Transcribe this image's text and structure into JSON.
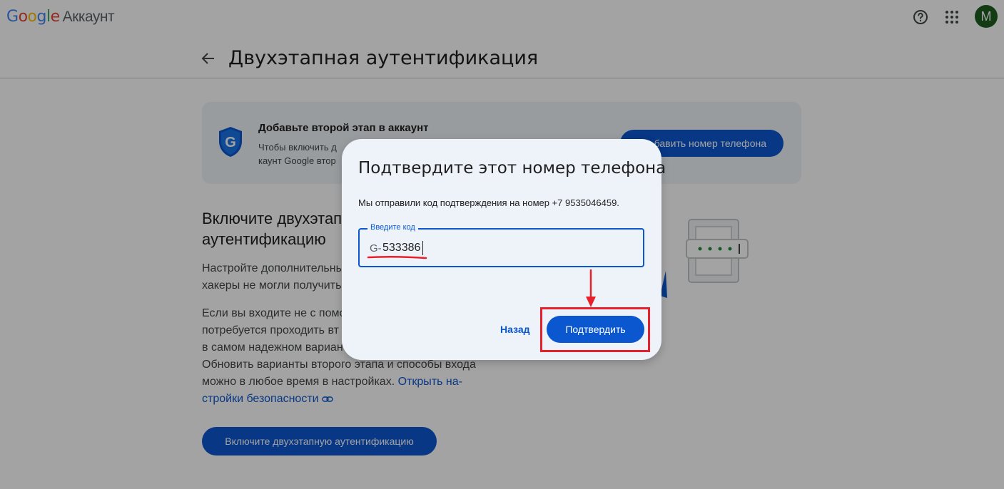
{
  "header": {
    "logo_letters": [
      "G",
      "o",
      "o",
      "g",
      "l",
      "e"
    ],
    "logo_suffix": "Аккаунт",
    "avatar_letter": "M"
  },
  "title_row": {
    "title": "Двухэтапная аутентификация"
  },
  "banner": {
    "title": "Добавьте второй этап в аккаунт",
    "line1": "Чтобы включить д",
    "line2": "каунт Google втор",
    "button_label": "бавить номер телефона"
  },
  "section": {
    "title_line1": "Включите двухэтап",
    "title_line2": "аутентификацию",
    "para1_line1": "Настройте дополнительны",
    "para1_line2": "хакеры не могли получить",
    "para2_line1": "Если вы входите не с помо",
    "para2_line2": "потребуется проходить вт",
    "para2_line3": "в самом надежном вариан",
    "para2_line4": "Обновить варианты второго этапа и способы входа",
    "para2_line5": "можно в любое время в настройках.",
    "link_part1": "Открыть на-",
    "link_part2": "стройки безопасности",
    "main_button": "Включите двухэтапную аутентификацию"
  },
  "dialog": {
    "title": "Подтвердите этот номер телефона",
    "text": "Мы отправили код подтверждения на номер +7 9535046459.",
    "field_label": "Введите код",
    "prefix": "G-",
    "code_value": "533386",
    "back_label": "Назад",
    "confirm_label": "Подтвердить"
  },
  "colors": {
    "primary": "#0b57d0",
    "annotation": "#e8202b",
    "avatar_bg": "#1e5e20"
  }
}
